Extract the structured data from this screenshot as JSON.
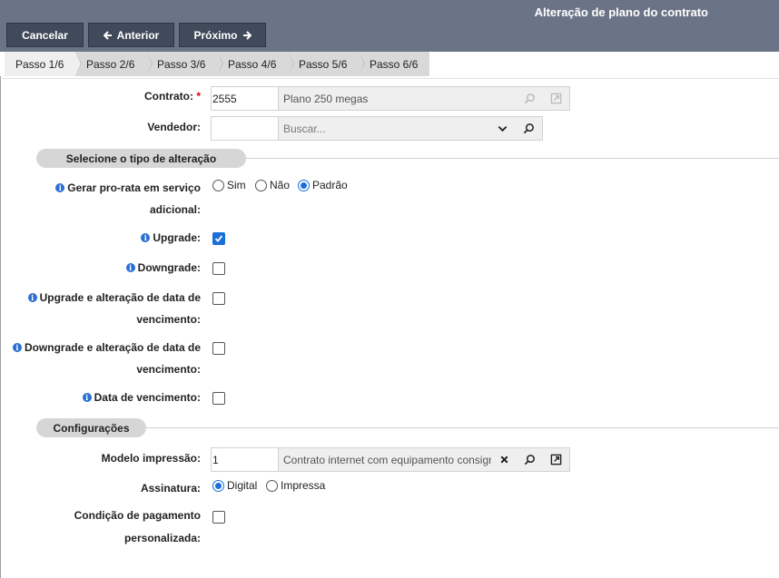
{
  "header": {
    "title": "Alteração de plano do contrato",
    "cancel_label": "Cancelar",
    "prev_label": "Anterior",
    "next_label": "Próximo"
  },
  "steps": [
    "Passo 1/6",
    "Passo 2/6",
    "Passo 3/6",
    "Passo 4/6",
    "Passo 5/6",
    "Passo 6/6"
  ],
  "form": {
    "contract": {
      "label": "Contrato:",
      "required_mark": "*",
      "code": "2555",
      "description": "Plano 250 megas"
    },
    "seller": {
      "label": "Vendedor:",
      "code": "",
      "placeholder": "Buscar..."
    },
    "section1": "Selecione o tipo de alteração",
    "prorata": {
      "label_line1": "Gerar pro-rata em serviço",
      "label_line2": "adicional:",
      "options": [
        "Sim",
        "Não",
        "Padrão"
      ],
      "selected": "Padrão"
    },
    "upgrade": {
      "label": "Upgrade:",
      "checked": true
    },
    "downgrade": {
      "label": "Downgrade:",
      "checked": false
    },
    "upgrade_date": {
      "label_line1": "Upgrade e alteração de data de",
      "label_line2": "vencimento:",
      "checked": false
    },
    "downgrade_date": {
      "label_line1": "Downgrade e alteração de data de",
      "label_line2": "vencimento:",
      "checked": false
    },
    "due_date": {
      "label": "Data de vencimento:",
      "checked": false
    },
    "section2": "Configurações",
    "print_model": {
      "label": "Modelo impressão:",
      "code": "1",
      "description": "Contrato internet com equipamento consignado"
    },
    "signature": {
      "label": "Assinatura:",
      "options": [
        "Digital",
        "Impressa"
      ],
      "selected": "Digital"
    },
    "payment": {
      "label_line1": "Condição de pagamento",
      "label_line2": "personalizada:",
      "checked": false
    }
  },
  "colors": {
    "header_bg": "#6b7486",
    "button_bg": "#404a5a",
    "accent": "#1a6fd8",
    "info_icon": "#2a6fd3"
  }
}
